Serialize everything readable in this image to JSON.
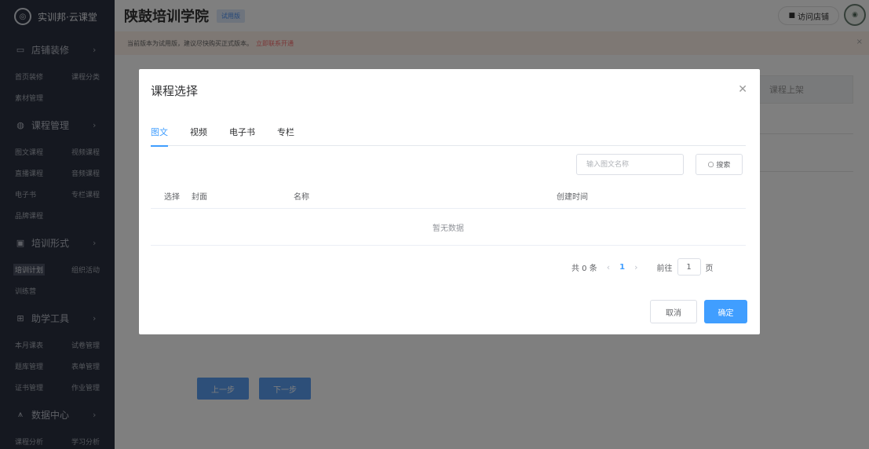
{
  "brand": {
    "name": "实训邦·云课堂"
  },
  "sidebar": {
    "groups": [
      {
        "icon": "store-icon",
        "label": "店铺装修",
        "items": [
          "首页装修",
          "课程分类",
          "素材管理"
        ]
      },
      {
        "icon": "course-icon",
        "label": "课程管理",
        "items": [
          "图文课程",
          "视频课程",
          "直播课程",
          "音频课程",
          "电子书",
          "专栏课程",
          "品牌课程"
        ]
      },
      {
        "icon": "training-icon",
        "label": "培训形式",
        "items": [
          "培训计划",
          "组织活动",
          "训练营"
        ]
      },
      {
        "icon": "tools-icon",
        "label": "助学工具",
        "items": [
          "本月课表",
          "试卷管理",
          "题库管理",
          "表单管理",
          "证书管理",
          "作业管理"
        ]
      },
      {
        "icon": "data-icon",
        "label": "数据中心",
        "items": [
          "课程分析",
          "学习分析"
        ]
      }
    ],
    "active_item": "培训计划"
  },
  "header": {
    "school_name": "陕鼓培训学院",
    "trial_badge": "试用版",
    "visit_store": "访问店铺"
  },
  "notice": {
    "text": "当前版本为试用版，建议尽快购买正式版本。",
    "link": "立即联系开通"
  },
  "background": {
    "shelf_label": "课程上架",
    "prev_button": "上一步",
    "next_button": "下一步"
  },
  "modal": {
    "title": "课程选择",
    "tabs": [
      "图文",
      "视频",
      "电子书",
      "专栏"
    ],
    "active_tab": "图文",
    "search_placeholder": "输入图文名称",
    "search_button": "搜索",
    "columns": [
      "选择",
      "封面",
      "名称",
      "创建时间"
    ],
    "empty_text": "暂无数据",
    "pagination": {
      "total_text": "共 0 条",
      "current_page": "1",
      "goto_label": "前往",
      "goto_value": "1",
      "page_unit": "页"
    },
    "cancel_button": "取消",
    "confirm_button": "确定"
  },
  "colors": {
    "primary": "#409eff",
    "sidebar_bg": "#2b3140",
    "notice_link": "#f56c6c"
  }
}
